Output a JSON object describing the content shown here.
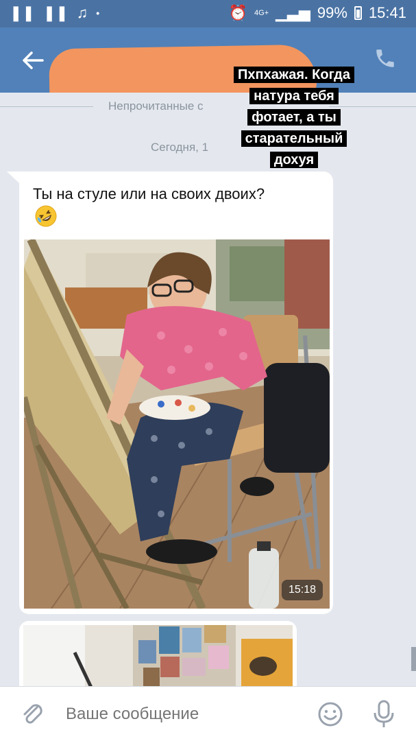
{
  "status_bar": {
    "left_icons": [
      "notification-icon",
      "notification-icon",
      "music-icon",
      "dot-icon"
    ],
    "network": "4G+",
    "battery": "99%",
    "time": "15:41"
  },
  "header": {
    "back_icon": "arrow-left-icon",
    "call_icon": "phone-icon",
    "redaction_color": "#f2955f"
  },
  "chat": {
    "unread_divider": "Непрочитанные с",
    "date": "Сегодня, 1",
    "message": {
      "text": "Ты на стуле или на своих двоих?",
      "emoji": "rolling-on-floor-laughing-emoji",
      "photo_time": "15:18"
    }
  },
  "caption": {
    "lines": [
      "Пхпхажая. Когда",
      "натура тебя",
      "фотает, а ты",
      "старательный",
      "дохуя"
    ]
  },
  "input": {
    "placeholder": "Ваше сообщение",
    "attach_icon": "paperclip-icon",
    "sticker_icon": "smile-icon",
    "voice_icon": "microphone-icon"
  },
  "colors": {
    "status_bar": "#4a73a4",
    "header": "#5181b8",
    "chat_bg": "#e4e8ee"
  }
}
